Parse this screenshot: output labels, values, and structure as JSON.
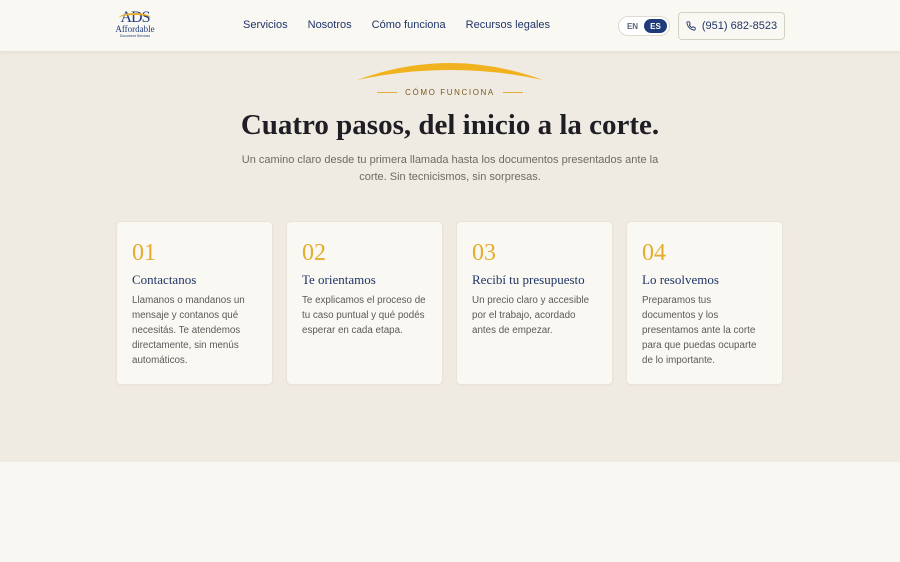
{
  "header": {
    "logo": {
      "mark": "ADS",
      "name": "Affordable",
      "sub": "Document Services"
    },
    "nav": [
      "Servicios",
      "Nosotros",
      "Cómo funciona",
      "Recursos legales"
    ],
    "lang": {
      "en": "EN",
      "es": "ES",
      "active": "ES"
    },
    "phone": "(951) 682-8523"
  },
  "hero": {
    "eyebrow": "CÓMO FUNCIONA",
    "title": "Cuatro pasos, del inicio a la corte.",
    "subtitle": "Un camino claro desde tu primera llamada hasta los documentos presentados ante la corte. Sin tecnicismos, sin sorpresas."
  },
  "steps": [
    {
      "num": "01",
      "title": "Contactanos",
      "text": "Llamanos o mandanos un mensaje y contanos qué necesitás. Te atendemos directamente, sin menús automáticos."
    },
    {
      "num": "02",
      "title": "Te orientamos",
      "text": "Te explicamos el proceso de tu caso puntual y qué podés esperar en cada etapa."
    },
    {
      "num": "03",
      "title": "Recibí tu presupuesto",
      "text": "Un precio claro y accesible por el trabajo, acordado antes de empezar."
    },
    {
      "num": "04",
      "title": "Lo resolvemos",
      "text": "Preparamos tus documentos y los presentamos ante la corte para que puedas ocuparte de lo importante."
    }
  ],
  "colors": {
    "accent": "#e5ac2d",
    "brand": "#1f3b7a",
    "hero_bg": "#f0ebe2"
  }
}
